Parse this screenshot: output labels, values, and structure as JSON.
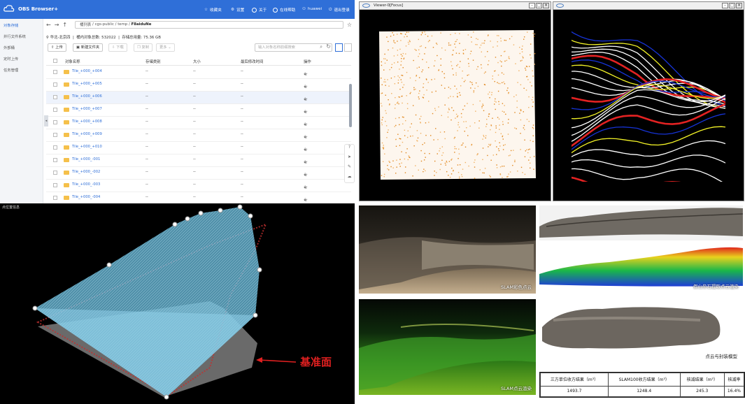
{
  "obs": {
    "app_title": "OBS Browser+",
    "menu": [
      "收藏夹",
      "设置",
      "关于",
      "在线帮助",
      "huawei",
      "退出登录"
    ],
    "sidebar": [
      "对象存储",
      "并行文件系统",
      "外部桶",
      "定时上传",
      "任务管理"
    ],
    "breadcrumb": {
      "root": "桶列表",
      "sep": "/",
      "p1": "cgs-public",
      "p2": "temp",
      "current": "F8aiduNe"
    },
    "info": {
      "region": "华北-北京四",
      "count_label": "桶内对象总数:",
      "count": "532022",
      "size_label": "存储总用量:",
      "size": "75.36 GB"
    },
    "toolbar": {
      "upload": "上传",
      "new_folder": "新建文件夹",
      "download": "下载",
      "copy": "复制",
      "more": "更多"
    },
    "search_placeholder": "输入对象名称前缀搜索",
    "columns": [
      "对象名称",
      "存储类别",
      "大小",
      "最后修改时间",
      "操作"
    ],
    "rows": [
      {
        "name": "Tile_+000_+004",
        "cls": "--",
        "size": "--",
        "time": "--"
      },
      {
        "name": "Tile_+000_+005",
        "cls": "--",
        "size": "--",
        "time": "--"
      },
      {
        "name": "Tile_+000_+006",
        "cls": "--",
        "size": "--",
        "time": "--"
      },
      {
        "name": "Tile_+000_+007",
        "cls": "--",
        "size": "--",
        "time": "--"
      },
      {
        "name": "Tile_+000_+008",
        "cls": "--",
        "size": "--",
        "time": "--"
      },
      {
        "name": "Tile_+000_+009",
        "cls": "--",
        "size": "--",
        "time": "--"
      },
      {
        "name": "Tile_+000_+010",
        "cls": "--",
        "size": "--",
        "time": "--"
      },
      {
        "name": "Tile_+000_-001",
        "cls": "--",
        "size": "--",
        "time": "--"
      },
      {
        "name": "Tile_+000_-002",
        "cls": "--",
        "size": "--",
        "time": "--"
      },
      {
        "name": "Tile_+000_-003",
        "cls": "--",
        "size": "--",
        "time": "--"
      },
      {
        "name": "Tile_+000_-004",
        "cls": "--",
        "size": "--",
        "time": "--"
      }
    ],
    "accent": "#2f6fd8"
  },
  "viewer": {
    "title": "Viewer-0[Focus]"
  },
  "bl_corner": "点位置信息",
  "annotation": "基准面",
  "captions": {
    "slam_color": "SLAM彩色点云",
    "rock_render": "假山垒石提取点云渲染",
    "slam_render": "SLAM点云渲染",
    "model": "点云与封装模型"
  },
  "table": {
    "headers": [
      "三方单位收方结果（m³）",
      "SLAM100收方结果（m³）",
      "核减结果（m³）",
      "核减率"
    ],
    "values": [
      "1493.7",
      "1248.4",
      "245.3",
      "16.4%"
    ]
  }
}
